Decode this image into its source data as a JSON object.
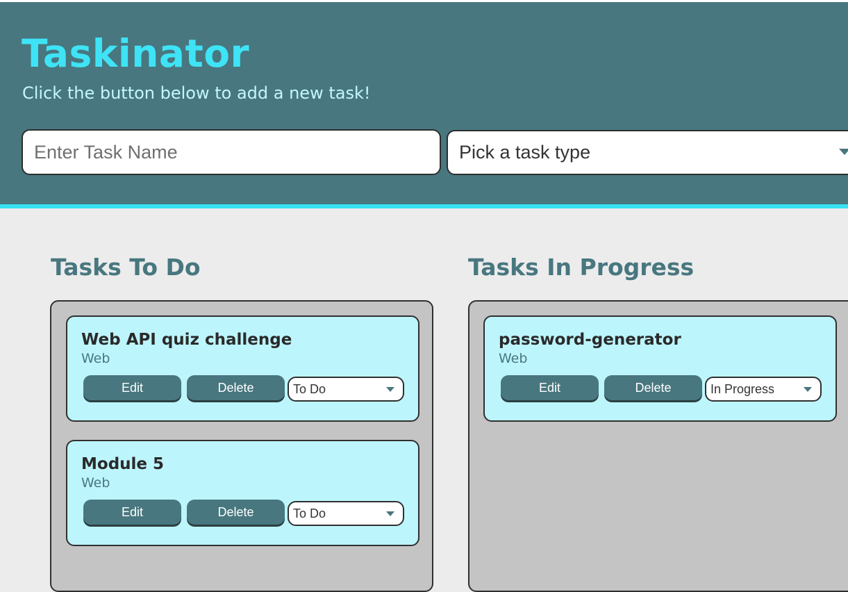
{
  "header": {
    "title": "Taskinator",
    "subtitle": "Click the button below to add a new task!"
  },
  "form": {
    "task_name_placeholder": "Enter Task Name",
    "task_type_selected": "Pick a task type",
    "task_type_dropdown_icon": "caret-down-icon"
  },
  "columns": [
    {
      "title": "Tasks To Do",
      "tasks": [
        {
          "name": "Web API quiz challenge",
          "type": "Web",
          "edit_label": "Edit",
          "delete_label": "Delete",
          "status": "To Do"
        },
        {
          "name": "Module 5",
          "type": "Web",
          "edit_label": "Edit",
          "delete_label": "Delete",
          "status": "To Do"
        }
      ]
    },
    {
      "title": "Tasks In Progress",
      "tasks": [
        {
          "name": "password-generator",
          "type": "Web",
          "edit_label": "Edit",
          "delete_label": "Delete",
          "status": "In Progress"
        }
      ]
    }
  ],
  "colors": {
    "header_bg": "#48777f",
    "accent_cyan": "#3fe3f6",
    "card_bg": "#bdf5fc",
    "column_bg": "#c4c4c4",
    "page_bg": "#ececec"
  }
}
